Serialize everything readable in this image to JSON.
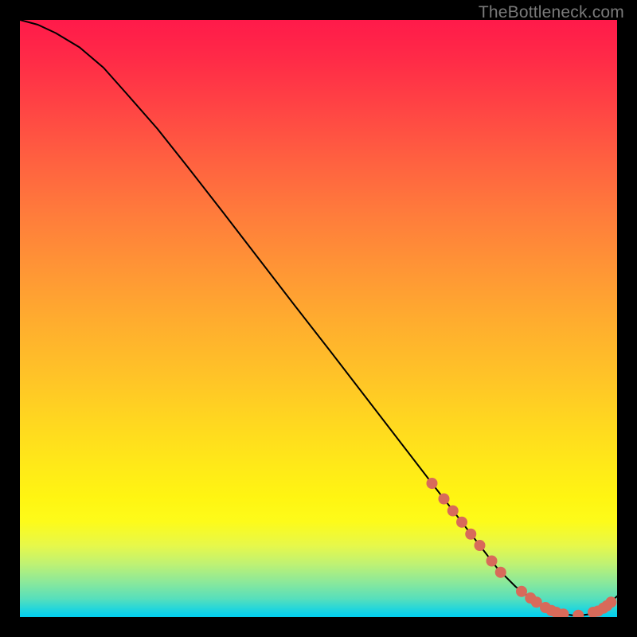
{
  "watermark": "TheBottleneck.com",
  "colors": {
    "background": "#000000",
    "gradient_top": "#ff1a4a",
    "gradient_bottom": "#00cff0",
    "line": "#000000",
    "marker": "#d86a5a",
    "watermark_text": "#7a7a7a"
  },
  "chart_data": {
    "type": "line",
    "title": "",
    "xlabel": "",
    "ylabel": "",
    "xlim": [
      0,
      100
    ],
    "ylim": [
      0,
      100
    ],
    "grid": false,
    "legend": false,
    "series": [
      {
        "name": "bottleneck-curve",
        "x": [
          0,
          3,
          6,
          10,
          14,
          18,
          23,
          28,
          34,
          40,
          46,
          52,
          58,
          64,
          69,
          73,
          77,
          80,
          83,
          86,
          88.5,
          90.5,
          92.5,
          94,
          95.5,
          97,
          98.5,
          100
        ],
        "y": [
          100,
          99.2,
          97.8,
          95.4,
          92.0,
          87.5,
          81.8,
          75.5,
          67.8,
          60.0,
          52.2,
          44.5,
          36.7,
          28.9,
          22.4,
          17.2,
          12.0,
          8.1,
          5.1,
          2.8,
          1.3,
          0.6,
          0.3,
          0.3,
          0.5,
          1.1,
          2.1,
          3.5
        ]
      }
    ],
    "markers": {
      "name": "highlighted-points",
      "points": [
        {
          "x": 69,
          "y": 22.4
        },
        {
          "x": 71,
          "y": 19.8
        },
        {
          "x": 72.5,
          "y": 17.8
        },
        {
          "x": 74,
          "y": 15.9
        },
        {
          "x": 75.5,
          "y": 13.9
        },
        {
          "x": 77,
          "y": 12.0
        },
        {
          "x": 79,
          "y": 9.4
        },
        {
          "x": 80.5,
          "y": 7.5
        },
        {
          "x": 84,
          "y": 4.3
        },
        {
          "x": 85.5,
          "y": 3.2
        },
        {
          "x": 86.5,
          "y": 2.5
        },
        {
          "x": 88,
          "y": 1.6
        },
        {
          "x": 89,
          "y": 1.1
        },
        {
          "x": 89.8,
          "y": 0.8
        },
        {
          "x": 91,
          "y": 0.5
        },
        {
          "x": 93.5,
          "y": 0.3
        },
        {
          "x": 96,
          "y": 0.8
        },
        {
          "x": 96.8,
          "y": 1.0
        },
        {
          "x": 97.7,
          "y": 1.5
        },
        {
          "x": 98.3,
          "y": 1.9
        },
        {
          "x": 99,
          "y": 2.5
        }
      ]
    }
  }
}
